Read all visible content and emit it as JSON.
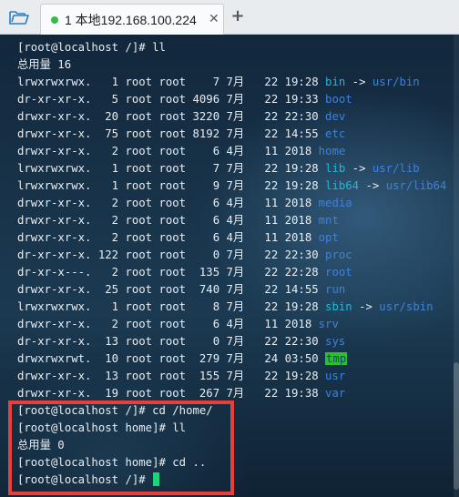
{
  "tab": {
    "label": "1 本地192.168.100.224",
    "close": "✕"
  },
  "toolbar": {
    "add": "+"
  },
  "lines": [
    [
      {
        "t": "[root@localhost /]# ll"
      }
    ],
    [
      {
        "t": "总用量 16"
      }
    ],
    [
      {
        "t": "lrwxrwxrwx.   1 root root    7 7月   22 19:28 "
      },
      {
        "t": "bin",
        "c": "lnk"
      },
      {
        "t": " -> "
      },
      {
        "t": "usr/bin",
        "c": "dir"
      }
    ],
    [
      {
        "t": "dr-xr-xr-x.   5 root root 4096 7月   22 19:33 "
      },
      {
        "t": "boot",
        "c": "dir"
      }
    ],
    [
      {
        "t": "drwxr-xr-x.  20 root root 3220 7月   22 22:30 "
      },
      {
        "t": "dev",
        "c": "dir"
      }
    ],
    [
      {
        "t": "drwxr-xr-x.  75 root root 8192 7月   22 14:55 "
      },
      {
        "t": "etc",
        "c": "dir"
      }
    ],
    [
      {
        "t": "drwxr-xr-x.   2 root root    6 4月   11 2018 "
      },
      {
        "t": "home",
        "c": "dir"
      }
    ],
    [
      {
        "t": "lrwxrwxrwx.   1 root root    7 7月   22 19:28 "
      },
      {
        "t": "lib",
        "c": "lnk"
      },
      {
        "t": " -> "
      },
      {
        "t": "usr/lib",
        "c": "dir"
      }
    ],
    [
      {
        "t": "lrwxrwxrwx.   1 root root    9 7月   22 19:28 "
      },
      {
        "t": "lib64",
        "c": "lnk"
      },
      {
        "t": " -> "
      },
      {
        "t": "usr/lib64",
        "c": "dir"
      }
    ],
    [
      {
        "t": "drwxr-xr-x.   2 root root    6 4月   11 2018 "
      },
      {
        "t": "media",
        "c": "dir"
      }
    ],
    [
      {
        "t": "drwxr-xr-x.   2 root root    6 4月   11 2018 "
      },
      {
        "t": "mnt",
        "c": "dir"
      }
    ],
    [
      {
        "t": "drwxr-xr-x.   2 root root    6 4月   11 2018 "
      },
      {
        "t": "opt",
        "c": "dir"
      }
    ],
    [
      {
        "t": "dr-xr-xr-x. 122 root root    0 7月   22 22:30 "
      },
      {
        "t": "proc",
        "c": "dir"
      }
    ],
    [
      {
        "t": "dr-xr-x---.   2 root root  135 7月   22 22:28 "
      },
      {
        "t": "root",
        "c": "dir"
      }
    ],
    [
      {
        "t": "drwxr-xr-x.  25 root root  740 7月   22 14:55 "
      },
      {
        "t": "run",
        "c": "dir"
      }
    ],
    [
      {
        "t": "lrwxrwxrwx.   1 root root    8 7月   22 19:28 "
      },
      {
        "t": "sbin",
        "c": "lnk"
      },
      {
        "t": " -> "
      },
      {
        "t": "usr/sbin",
        "c": "dir"
      }
    ],
    [
      {
        "t": "drwxr-xr-x.   2 root root    6 4月   11 2018 "
      },
      {
        "t": "srv",
        "c": "dir"
      }
    ],
    [
      {
        "t": "dr-xr-xr-x.  13 root root    0 7月   22 22:30 "
      },
      {
        "t": "sys",
        "c": "dir"
      }
    ],
    [
      {
        "t": "drwxrwxrwt.  10 root root  279 7月   24 03:50 "
      },
      {
        "t": "tmp",
        "c": "sticky"
      }
    ],
    [
      {
        "t": "drwxr-xr-x.  13 root root  155 7月   22 19:28 "
      },
      {
        "t": "usr",
        "c": "dir"
      }
    ],
    [
      {
        "t": "drwxr-xr-x.  19 root root  267 7月   22 19:38 "
      },
      {
        "t": "var",
        "c": "dir"
      }
    ],
    [
      {
        "t": "[root@localhost /]# cd /home/"
      }
    ],
    [
      {
        "t": "[root@localhost home]# ll"
      }
    ],
    [
      {
        "t": "总用量 0"
      }
    ],
    [
      {
        "t": "[root@localhost home]# cd .."
      }
    ],
    [
      {
        "t": "[root@localhost /]# "
      },
      {
        "t": "",
        "c": "cursor"
      }
    ]
  ],
  "colors": {
    "link": "#23b8d6",
    "directory": "#3d82db",
    "sticky_bg": "#2ebf2e",
    "highlight_border": "#e7403b",
    "tab_dot": "#2fbf4a"
  }
}
